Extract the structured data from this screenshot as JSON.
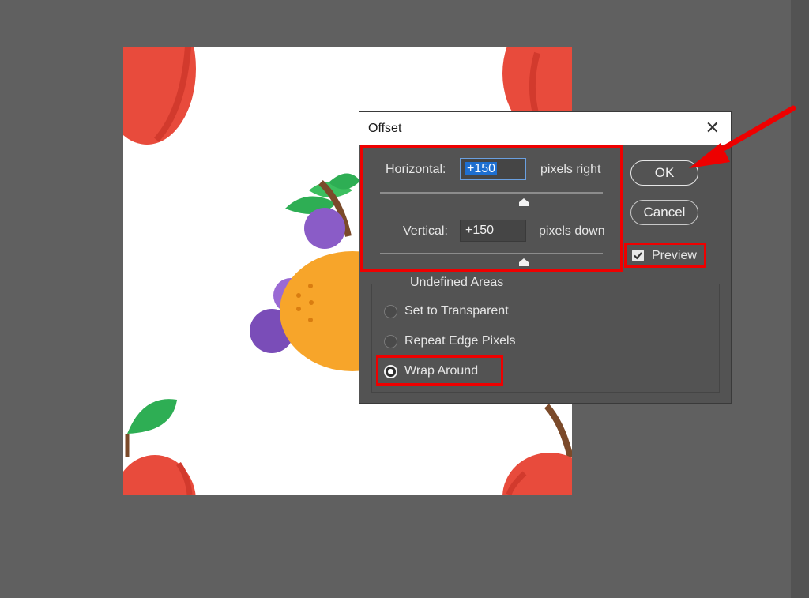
{
  "dialog": {
    "title": "Offset",
    "close_icon": "close-icon",
    "horizontal": {
      "label": "Horizontal:",
      "value": "+150",
      "unit": "pixels right"
    },
    "vertical": {
      "label": "Vertical:",
      "value": "+150",
      "unit": "pixels down"
    },
    "ok_label": "OK",
    "cancel_label": "Cancel",
    "preview": {
      "label": "Preview",
      "checked": true
    },
    "undefined_areas": {
      "legend": "Undefined Areas",
      "options": [
        {
          "label": "Set to Transparent",
          "selected": false
        },
        {
          "label": "Repeat Edge Pixels",
          "selected": false
        },
        {
          "label": "Wrap Around",
          "selected": true
        }
      ]
    }
  },
  "annotations": {
    "highlight_color": "#ee0000",
    "arrow_icon": "red-arrow-icon"
  },
  "canvas": {
    "background": "#ffffff"
  }
}
